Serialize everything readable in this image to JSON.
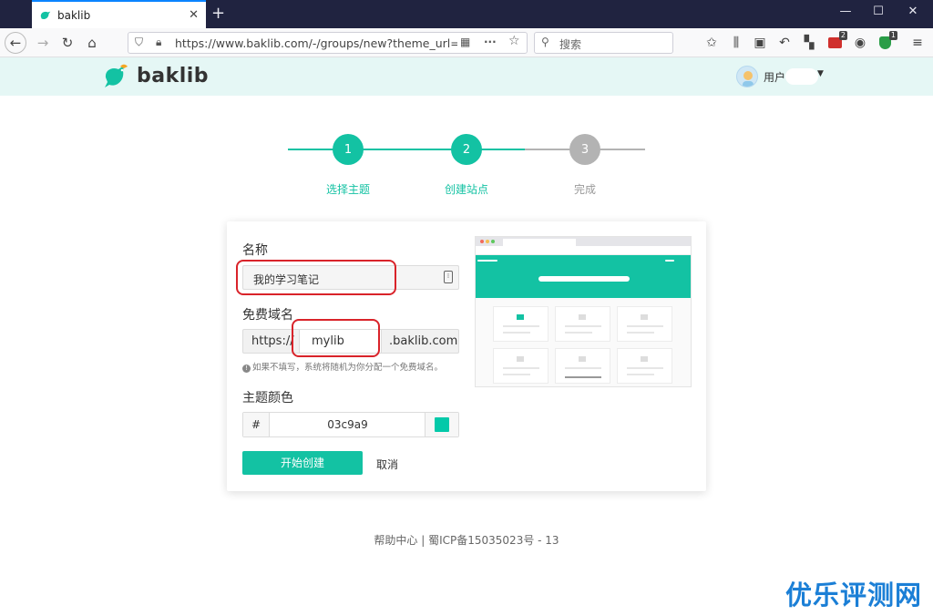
{
  "browser": {
    "tab_title": "baklib",
    "url": "https://www.baklib.com/-/groups/new?theme_url=htt",
    "search_placeholder": "搜索",
    "ext_badge_1": "2",
    "ext_badge_2": "1"
  },
  "header": {
    "logo_text": "baklib",
    "username": "用户"
  },
  "steps": [
    {
      "number": "1",
      "label": "选择主题"
    },
    {
      "number": "2",
      "label": "创建站点"
    },
    {
      "number": "3",
      "label": "完成"
    }
  ],
  "form": {
    "name_label": "名称",
    "name_value": "我的学习笔记",
    "domain_label": "免费域名",
    "domain_prefix": "https://",
    "domain_value": "mylib",
    "domain_suffix": ".baklib.com",
    "domain_hint": "如果不填写，系统将随机为你分配一个免费域名。",
    "color_label": "主题颜色",
    "color_hash": "#",
    "color_value": "03c9a9",
    "create_label": "开始创建",
    "cancel_label": "取消"
  },
  "footer": {
    "text": "帮助中心 | 蜀ICP备15035023号 - 13"
  },
  "watermark": "优乐评测网",
  "colors": {
    "accent": "#13c2a3",
    "theme": "#03c9a9",
    "inactive": "#b3b3b3",
    "annotation": "#d9232a"
  }
}
